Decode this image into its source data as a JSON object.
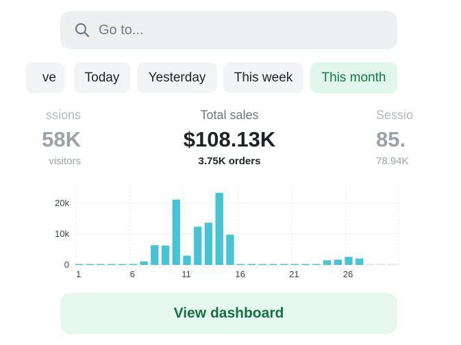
{
  "search": {
    "placeholder": "Go to...",
    "icon": "search-icon"
  },
  "filters": {
    "items": [
      "ve",
      "Today",
      "Yesterday",
      "This week",
      "This month"
    ],
    "active": "This month"
  },
  "metrics": {
    "left": {
      "label": "ssions",
      "value": "58K",
      "sub": "visitors"
    },
    "center": {
      "label": "Total sales",
      "value": "$108.13K",
      "sub": "3.75K orders"
    },
    "right": {
      "label": "Sessio",
      "value": "85.",
      "sub": "78.94K"
    }
  },
  "chart_data": {
    "type": "bar",
    "xlabel": "",
    "ylabel": "",
    "x_ticks": [
      "1",
      "6",
      "11",
      "16",
      "21",
      "26"
    ],
    "y_ticks": [
      "0",
      "10k",
      "20k"
    ],
    "ylim": [
      0,
      26000
    ],
    "grid": true,
    "color": "#45c4d5",
    "future_color": "#e4e6e9",
    "categories": [
      "1",
      "2",
      "3",
      "4",
      "5",
      "6",
      "7",
      "8",
      "9",
      "10",
      "11",
      "12",
      "13",
      "14",
      "15",
      "16",
      "17",
      "18",
      "19",
      "20",
      "21",
      "22",
      "23",
      "24",
      "25",
      "26",
      "27",
      "28",
      "29",
      "30"
    ],
    "values": [
      300,
      300,
      300,
      300,
      300,
      300,
      1100,
      6400,
      6300,
      21200,
      3000,
      12400,
      13700,
      23400,
      9800,
      300,
      300,
      300,
      300,
      300,
      300,
      300,
      300,
      1500,
      1700,
      2600,
      2100,
      400,
      400,
      400
    ],
    "future_from": 28
  },
  "actions": {
    "view_dashboard": "View dashboard"
  },
  "colors": {
    "accent": "#0f7a4c",
    "active_chip_bg": "#e1f6ec",
    "bar": "#45c4d5",
    "button_bg": "#e6f7ee"
  }
}
